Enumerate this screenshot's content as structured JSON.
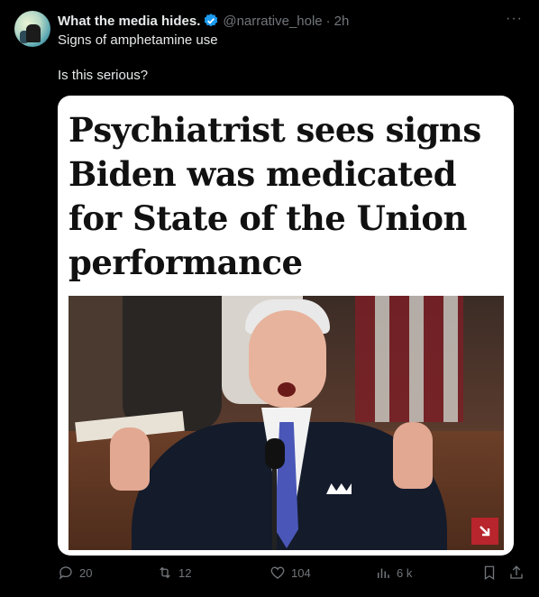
{
  "tweet": {
    "author_name": "What the media hides.",
    "handle": "@narrative_hole",
    "separator": "·",
    "time": "2h",
    "more_label": "···",
    "text_line1": "Signs of amphetamine use",
    "text_line2": "Is this serious?",
    "verified_color": "#1d9bf0"
  },
  "card": {
    "headline": "Psychiatrist sees signs Biden was medicated for State of the Union performance",
    "photo_subject": "man speaking at podium pointing both fingers up",
    "badge_color": "#b8252c"
  },
  "actions": {
    "replies": "20",
    "retweets": "12",
    "likes": "104",
    "views": "6 k",
    "icons": [
      "reply-icon",
      "retweet-icon",
      "like-icon",
      "views-icon",
      "bookmark-icon",
      "share-icon"
    ]
  }
}
